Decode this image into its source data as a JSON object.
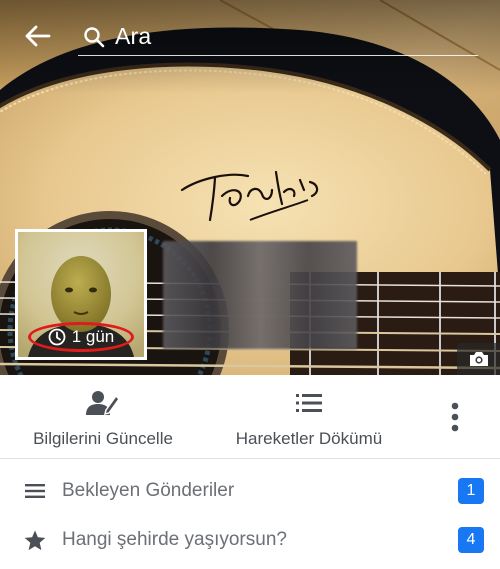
{
  "header": {
    "back_icon": "arrow-left-icon",
    "search_icon": "search-icon",
    "search_placeholder": "Ara"
  },
  "cover": {
    "camera_icon": "camera-icon"
  },
  "profile": {
    "story_icon": "clock-icon",
    "story_age": "1 gün",
    "highlight_color": "#e01b1b"
  },
  "actions": {
    "update_info": {
      "label": "Bilgilerini Güncelle",
      "icon": "edit-profile-icon"
    },
    "activity_log": {
      "label": "Hareketler Dökümü",
      "icon": "list-icon"
    },
    "more_icon": "more-vertical-icon"
  },
  "list": [
    {
      "label": "Bekleyen Gönderiler",
      "icon": "menu-lines-icon",
      "badge": "1"
    },
    {
      "label": "Hangi şehirde yaşıyorsun?",
      "icon": "star-icon",
      "badge": "4"
    }
  ],
  "colors": {
    "accent": "#1877f2",
    "text": "#4b4f56"
  }
}
